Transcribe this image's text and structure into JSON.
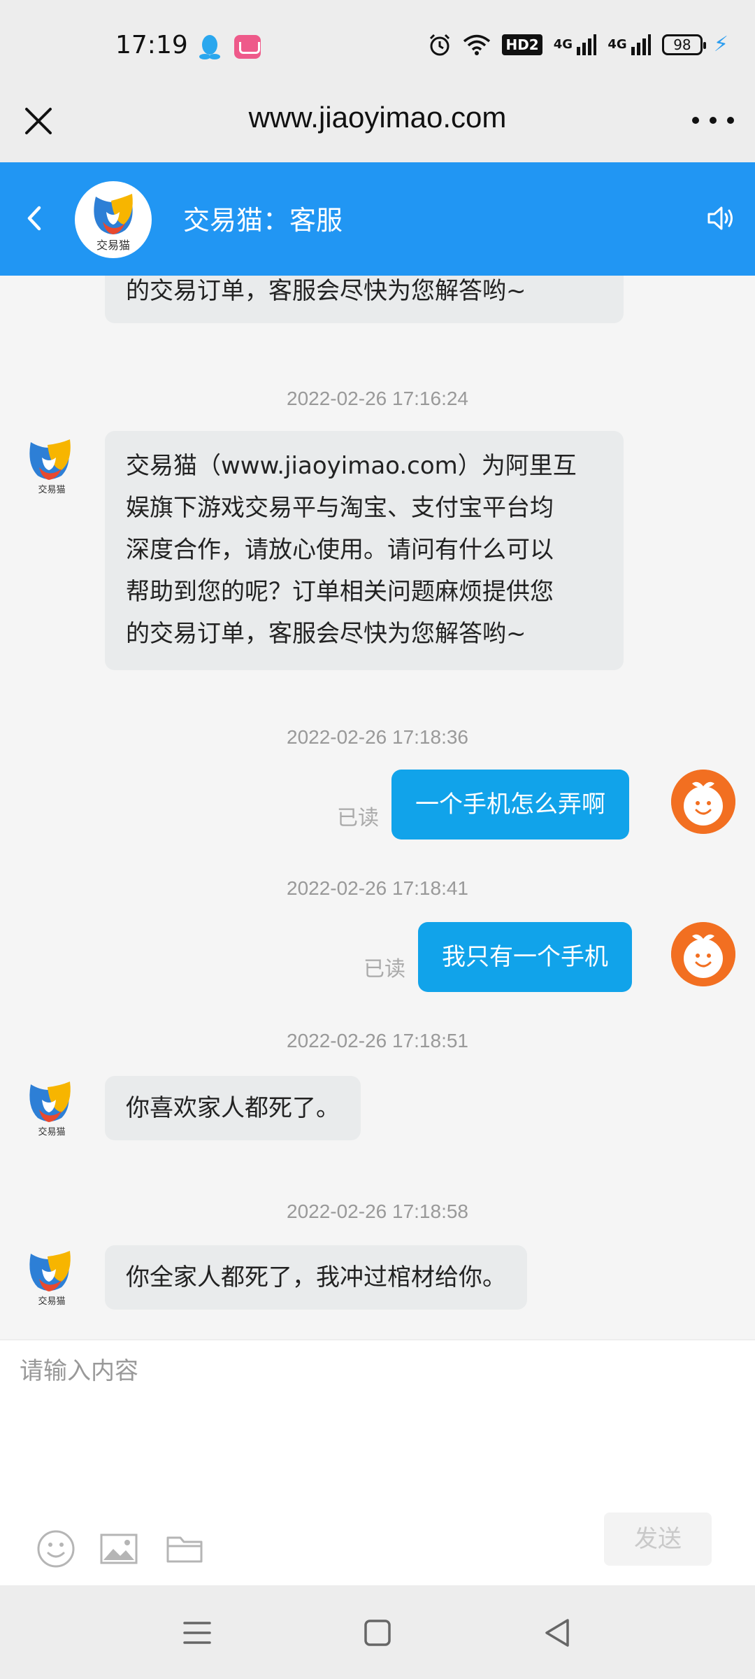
{
  "status_bar": {
    "time": "17:19",
    "hd_label": "HD2",
    "signal_1": "4G",
    "signal_2": "4G",
    "battery": "98"
  },
  "browser": {
    "url_title": "www.jiaoyimao.com"
  },
  "chat_header": {
    "title": "交易猫：客服",
    "logo_text": "交易猫"
  },
  "messages": [
    {
      "from": "service",
      "text": "的交易订单，客服会尽快为您解答哟~"
    },
    {
      "timestamp": "2022-02-26 17:16:24",
      "from": "service",
      "lines": [
        "交易猫（www.jiaoyimao.com）为阿里互",
        "娱旗下游戏交易平与淘宝、支付宝平台均",
        "深度合作，请放心使用。请问有什么可以",
        "帮助到您的呢？订单相关问题麻烦提供您",
        "的交易订单，客服会尽快为您解答哟~"
      ]
    },
    {
      "timestamp": "2022-02-26 17:18:36",
      "from": "user",
      "text": "一个手机怎么弄啊",
      "status": "已读"
    },
    {
      "timestamp": "2022-02-26 17:18:41",
      "from": "user",
      "text": "我只有一个手机",
      "status": "已读"
    },
    {
      "timestamp": "2022-02-26 17:18:51",
      "from": "service",
      "text": "你喜欢家人都死了。"
    },
    {
      "timestamp": "2022-02-26 17:18:58",
      "from": "service",
      "text": "你全家人都死了，我冲过棺材给你。"
    }
  ],
  "input": {
    "placeholder": "请输入内容",
    "send_label": "发送"
  },
  "colors": {
    "header_blue": "#2196f3",
    "user_bubble": "#11a3ea",
    "service_bubble": "#e9ebec",
    "avatar_orange": "#f26f21"
  },
  "icons": [
    "qq-icon",
    "alarm-icon",
    "wifi-icon",
    "close-icon",
    "more-icon",
    "back-icon",
    "speaker-icon",
    "emoji-icon",
    "image-icon",
    "folder-icon",
    "menu-icon",
    "home-icon",
    "back-nav-icon"
  ]
}
